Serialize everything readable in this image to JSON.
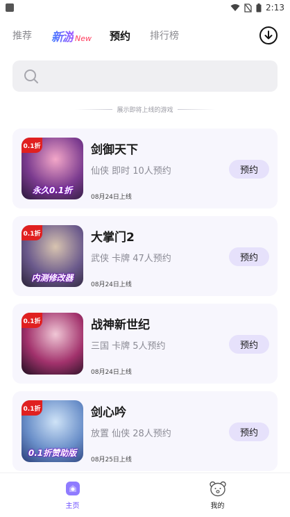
{
  "status_bar": {
    "time": "2:13"
  },
  "header": {
    "tabs": [
      {
        "label": "推荐"
      },
      {
        "label": "新游",
        "badge": "New"
      },
      {
        "label": "预约"
      },
      {
        "label": "排行榜"
      }
    ]
  },
  "search": {
    "placeholder": "",
    "value": ""
  },
  "section": {
    "label": "展示即将上线的游戏"
  },
  "games": [
    {
      "title": "剑御天下",
      "tags": "仙侠 即时 10人预约",
      "date": "08月24日上线",
      "button": "预约",
      "icon_badge": "0.1折",
      "icon_banner": "永久0.1折",
      "colors": [
        "#f3a7c8",
        "#7b3b8f",
        "#2a1a3a"
      ]
    },
    {
      "title": "大掌门2",
      "tags": "武侠 卡牌 47人预约",
      "date": "08月24日上线",
      "button": "预约",
      "icon_badge": "0.1折",
      "icon_banner": "内测修改器",
      "colors": [
        "#d8c4b0",
        "#6b5a8c",
        "#2b2338"
      ]
    },
    {
      "title": "战神新世纪",
      "tags": "三国 卡牌 5人预约",
      "date": "08月24日上线",
      "button": "预约",
      "icon_badge": "0.1折",
      "icon_banner": "",
      "colors": [
        "#f0c7d6",
        "#a2326c",
        "#1f1020"
      ]
    },
    {
      "title": "剑心吟",
      "tags": "放置 仙侠 28人预约",
      "date": "08月25日上线",
      "button": "预约",
      "icon_badge": "0.1折",
      "icon_banner": "0.1折赞助版",
      "colors": [
        "#cfe3f7",
        "#6a8fc9",
        "#2a3f7a"
      ]
    }
  ],
  "bottom_nav": [
    {
      "label": "主页",
      "icon": "home-icon",
      "active": true
    },
    {
      "label": "我的",
      "icon": "bear-icon",
      "active": false
    }
  ],
  "theme": {
    "accent": "#6a4cff",
    "button_bg": "#e6e1fb",
    "card_bg": "#f7f6fd"
  }
}
